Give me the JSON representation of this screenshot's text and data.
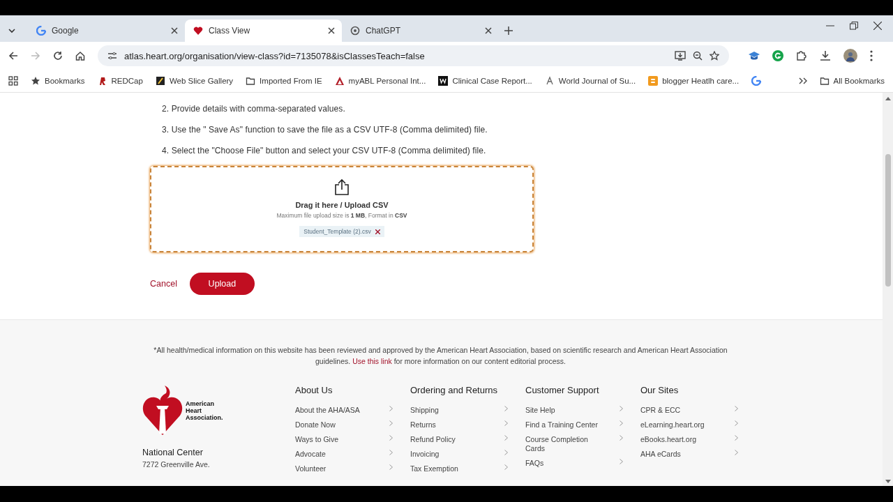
{
  "browser": {
    "tabs": [
      {
        "title": "Google",
        "selected": false,
        "kind": "google"
      },
      {
        "title": "Class View",
        "selected": true,
        "kind": "heart"
      },
      {
        "title": "ChatGPT",
        "selected": false,
        "kind": "openai"
      }
    ],
    "url": "atlas.heart.org/organisation/view-class?id=7135078&isClassesTeach=false",
    "bookmarks": [
      {
        "label": "Bookmarks",
        "kind": "star"
      },
      {
        "label": "REDCap",
        "kind": "redcap"
      },
      {
        "label": "Web Slice Gallery",
        "kind": "slice"
      },
      {
        "label": "Imported From IE",
        "kind": "folder"
      },
      {
        "label": "myABL Personal Int...",
        "kind": "abl"
      },
      {
        "label": "Clinical Case Report...",
        "kind": "w"
      },
      {
        "label": "World Journal of Su...",
        "kind": "wj"
      },
      {
        "label": "blogger Heatlh care...",
        "kind": "blogger"
      },
      {
        "kind": "google"
      }
    ],
    "all_bookmarks": "All Bookmarks"
  },
  "instructions": [
    "2. Provide details with comma-separated values.",
    "3. Use the \" Save As\" function to save the file as a CSV UTF-8 (Comma delimited) file.",
    "4. Select the \"Choose File\" button and select your CSV UTF-8 (Comma delimited) file."
  ],
  "dropzone": {
    "title": "Drag it here / Upload CSV",
    "hint": "Maximum file upload size is **1 MB**, Format in **CSV**",
    "file": "Student_Template (2).csv"
  },
  "buttons": {
    "cancel": "Cancel",
    "upload": "Upload"
  },
  "footer": {
    "disclaimer_start": "*All health/medical information on this website has been reviewed and approved by the American Heart Association, based on scientific research and American Heart Association guidelines.",
    "disclaimer_link": "Use this link",
    "disclaimer_end": "for more information on our content editorial process.",
    "logo_text": [
      "American",
      "Heart",
      "Association."
    ],
    "address_title": "National Center",
    "address_lines": [
      "7272 Greenville Ave."
    ],
    "columns": [
      {
        "title": "About Us",
        "links": [
          "About the AHA/ASA",
          "Donate Now",
          "Ways to Give",
          "Advocate",
          "Volunteer"
        ]
      },
      {
        "title": "Ordering and Returns",
        "links": [
          "Shipping",
          "Returns",
          "Refund Policy",
          "Invoicing",
          "Tax Exemption"
        ]
      },
      {
        "title": "Customer Support",
        "links": [
          "Site Help",
          "Find a Training Center",
          "Course Completion Cards",
          "FAQs"
        ]
      },
      {
        "title": "Our Sites",
        "links": [
          "CPR & ECC",
          "eLearning.heart.org",
          "eBooks.heart.org",
          "AHA eCards"
        ]
      }
    ]
  }
}
